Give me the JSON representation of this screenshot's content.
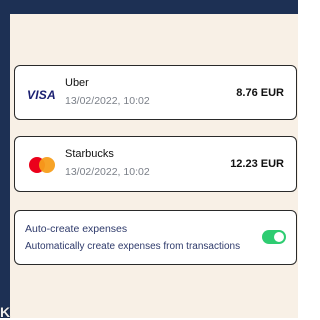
{
  "transactions": [
    {
      "merchant": "Uber",
      "datetime": "13/02/2022, 10:02",
      "amount": "8.76 EUR",
      "card_brand": "VISA",
      "brand_icon": "visa-logo"
    },
    {
      "merchant": "Starbucks",
      "datetime": "13/02/2022, 10:02",
      "amount": "12.23 EUR",
      "card_brand": "mastercard",
      "brand_icon": "mastercard-logo"
    }
  ],
  "auto_create": {
    "title": "Auto-create expenses",
    "subtitle": "Automatically create expenses from transactions",
    "enabled": true,
    "toggle_color": "#2ecc71"
  },
  "corner_glyph": "K",
  "colors": {
    "frame": "#1d3054",
    "panel": "#f8f0e6",
    "card_border": "#2a2a2a"
  }
}
